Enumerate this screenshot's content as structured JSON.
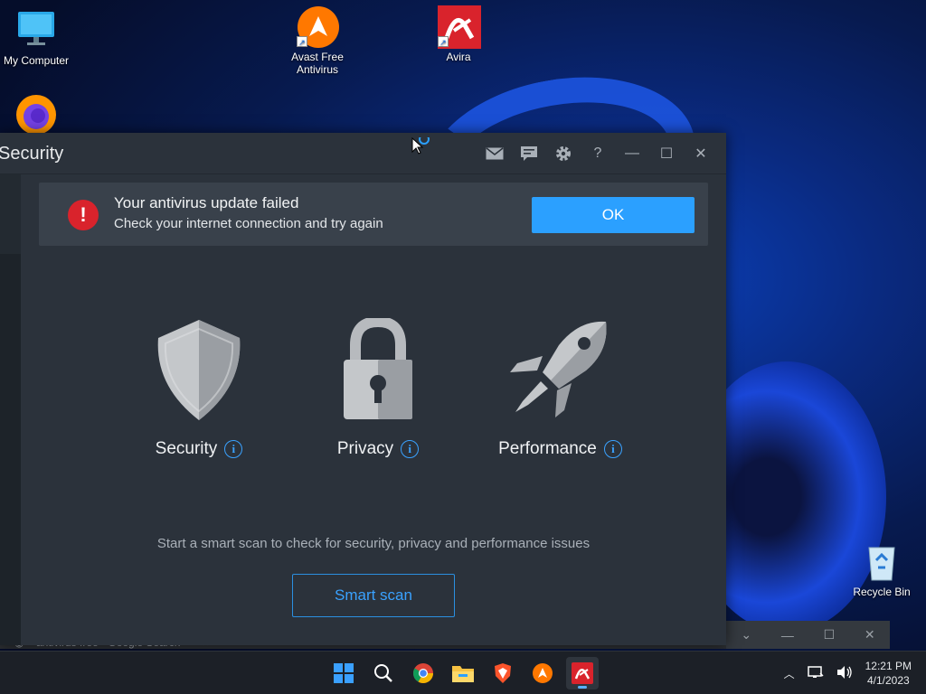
{
  "desktop": {
    "icons": [
      {
        "label": "My Computer",
        "icon": "monitor-icon"
      },
      {
        "label": "Avast Free Antivirus",
        "line1": "Avast Free",
        "line2": "Antivirus",
        "icon": "avast-icon"
      },
      {
        "label": "Avira",
        "icon": "avira-icon"
      },
      {
        "label": "Firefox",
        "icon": "firefox-icon"
      },
      {
        "label": "Recycle Bin",
        "icon": "recycle-bin-icon"
      }
    ]
  },
  "window": {
    "title": "Security",
    "toolbar_icons": [
      "mail-icon",
      "feedback-icon",
      "gear-icon",
      "help-icon",
      "minimize-icon",
      "maximize-icon",
      "close-icon"
    ],
    "help_glyph": "?"
  },
  "alert": {
    "title": "Your antivirus update failed",
    "subtitle": "Check your internet connection and try again",
    "ok_label": "OK",
    "icon_glyph": "!"
  },
  "features": [
    {
      "label": "Security",
      "icon": "shield-icon"
    },
    {
      "label": "Privacy",
      "icon": "padlock-icon"
    },
    {
      "label": "Performance",
      "icon": "rocket-icon"
    }
  ],
  "info_glyph": "i",
  "scan": {
    "description": "Start a smart scan to check for security, privacy and performance issues",
    "button_label": "Smart scan"
  },
  "background_window": {
    "tab_title": "antivirus free - Google Search"
  },
  "taskbar": {
    "apps": [
      "windows-start-icon",
      "search-icon",
      "chrome-icon",
      "file-explorer-icon",
      "brave-icon",
      "avast-icon",
      "avira-icon"
    ],
    "time": "12:21 PM",
    "date": "4/1/2023"
  },
  "colors": {
    "accent": "#2ba0ff",
    "alert_red": "#d9232c",
    "window_bg": "#2b323b"
  }
}
